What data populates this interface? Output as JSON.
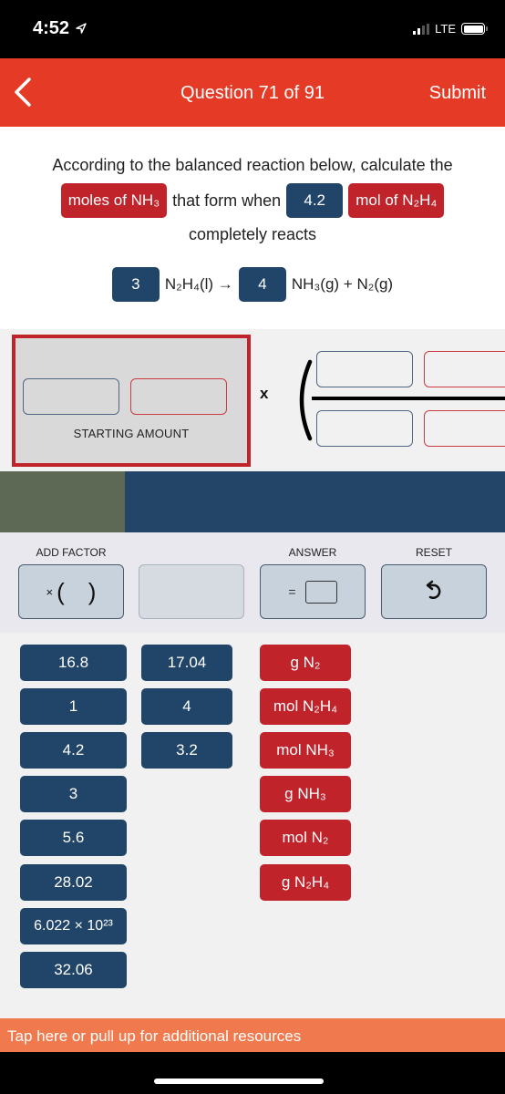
{
  "status_bar": {
    "time": "4:52",
    "location_icon": "location-arrow-icon",
    "network": "LTE",
    "signal_bars_active": 2,
    "signal_bars_total": 4,
    "battery_icon": "battery-icon"
  },
  "nav": {
    "back_icon": "chevron-left-icon",
    "title": "Question 71 of 91",
    "submit_label": "Submit",
    "color": "#e53b26"
  },
  "question": {
    "line1": "According to the balanced reaction below, calculate the",
    "target_chip": "moles of NH₃",
    "middle_text": "that form when",
    "amount_chip": "4.2",
    "unit_chip": "mol of N₂H₄",
    "line3": "completely reacts",
    "equation": {
      "coef1": "3",
      "reactant": "N₂H₄(l) →",
      "coef2": "4",
      "products": "NH₃(g) + N₂(g)"
    }
  },
  "workspace": {
    "starting_amount_label": "STARTING AMOUNT",
    "multiply_symbol": "x"
  },
  "tools": {
    "add_factor_label": "ADD FACTOR",
    "add_factor_symbol_x": "×",
    "add_factor_open": "(",
    "add_factor_close": ")",
    "answer_label": "ANSWER",
    "answer_equals": "=",
    "reset_label": "RESET",
    "reset_icon": "undo-arrow-icon"
  },
  "tiles": {
    "numbers_col1": [
      "16.8",
      "1",
      "4.2",
      "3",
      "5.6",
      "28.02",
      "6.022 × 10²³",
      "32.06"
    ],
    "numbers_col2": [
      "17.04",
      "4",
      "3.2"
    ],
    "units": [
      "g N₂",
      "mol N₂H₄",
      "mol NH₃",
      "g NH₃",
      "mol N₂",
      "g N₂H₄"
    ]
  },
  "footer": {
    "resources_text": "Tap here or pull up for additional resources",
    "color": "#f07a4e"
  },
  "colors": {
    "blue_tile": "#214568",
    "red_tile": "#c1232b"
  }
}
